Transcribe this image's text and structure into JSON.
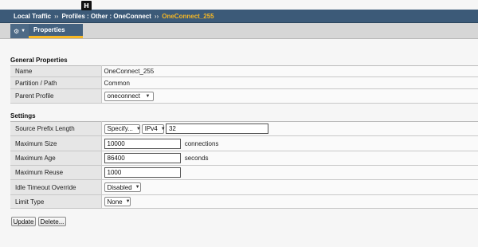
{
  "badge": "H",
  "breadcrumb": [
    "Local Traffic",
    "Profiles : Other : OneConnect",
    "OneConnect_255"
  ],
  "breadcrumb_sep": "››",
  "tabs": {
    "gear_icon": "gear-icon",
    "properties_label": "Properties"
  },
  "general": {
    "title": "General Properties",
    "name_label": "Name",
    "name_value": "OneConnect_255",
    "partition_label": "Partition / Path",
    "partition_value": "Common",
    "parent_label": "Parent Profile",
    "parent_value": "oneconnect"
  },
  "settings": {
    "title": "Settings",
    "source_prefix_label": "Source Prefix Length",
    "source_prefix_mode": "Specify...",
    "source_prefix_ipver": "IPv4",
    "source_prefix_value": "32",
    "max_size_label": "Maximum Size",
    "max_size_value": "10000",
    "max_size_unit": "connections",
    "max_age_label": "Maximum Age",
    "max_age_value": "86400",
    "max_age_unit": "seconds",
    "max_reuse_label": "Maximum Reuse",
    "max_reuse_value": "1000",
    "idle_timeout_label": "Idle Timeout Override",
    "idle_timeout_value": "Disabled",
    "limit_type_label": "Limit Type",
    "limit_type_value": "None"
  },
  "buttons": {
    "update": "Update",
    "delete": "Delete..."
  },
  "colors": {
    "header": "#3c5a78",
    "accent": "#f7b824"
  }
}
